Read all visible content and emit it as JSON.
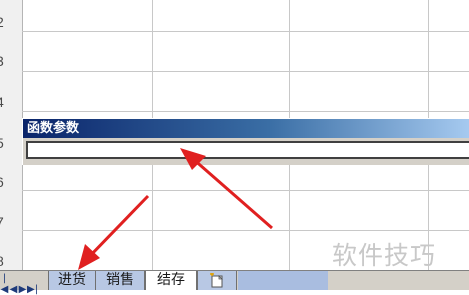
{
  "row_numbers": [
    "2",
    "3",
    "4",
    "5",
    "6",
    "7",
    "8"
  ],
  "function_dialog": {
    "title": "函数参数",
    "field_value": ""
  },
  "sheet_tabs": {
    "nav_first": "|◀",
    "nav_prev": "◀",
    "nav_next": "▶",
    "nav_last": "▶|",
    "tabs": [
      {
        "label": "进货",
        "active": false
      },
      {
        "label": "销售",
        "active": false
      },
      {
        "label": "结存",
        "active": true
      }
    ]
  },
  "colors": {
    "arrow": "#e02020",
    "title_bar_start": "#0a246a",
    "title_bar_end": "#a6caf0"
  },
  "watermark": "软件技巧"
}
